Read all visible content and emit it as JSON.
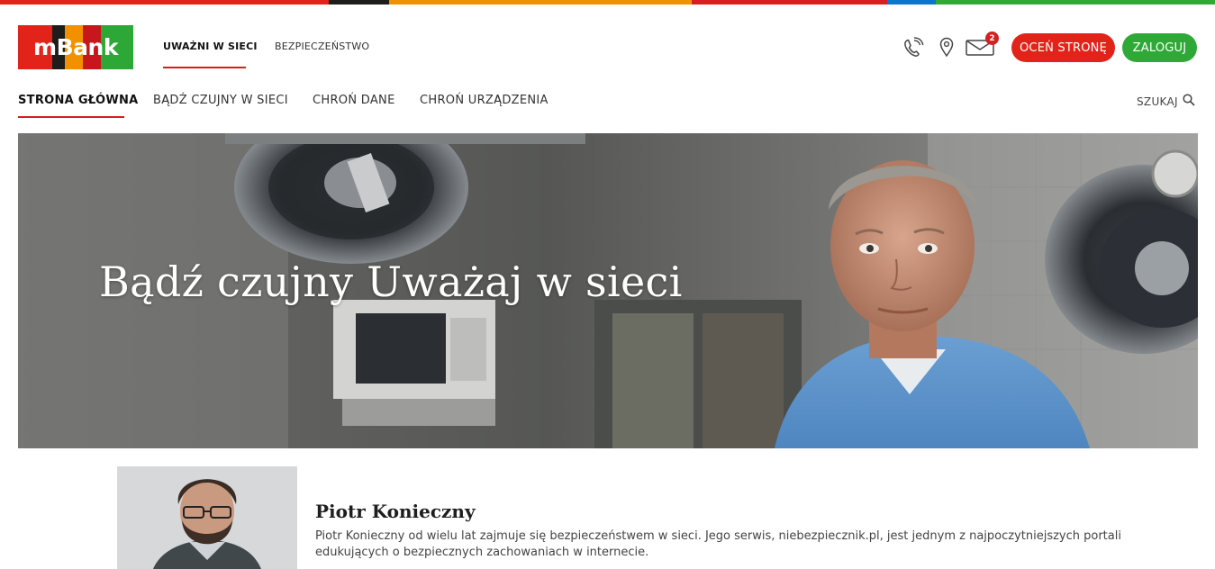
{
  "brand": {
    "name": "mBank",
    "stripe_colors": [
      "#e2231a",
      "#1d1d1b",
      "#f29100",
      "#d81e1e",
      "#0a78c8",
      "#34a836"
    ],
    "logo_colors": [
      "#e2231a",
      "#1d1d1b",
      "#f29100",
      "#c7161d",
      "#2da836"
    ]
  },
  "top_nav": {
    "tabs": [
      {
        "label": "UWAŻNI W SIECI",
        "active": true
      },
      {
        "label": "BEZPIECZEŃSTWO",
        "active": false
      }
    ]
  },
  "utility": {
    "icons": [
      "phone-icon",
      "location-pin-icon",
      "mail-icon"
    ],
    "mail_badge": "2",
    "rate_button": "OCEŃ STRONĘ",
    "login_button": "ZALOGUJ",
    "rate_color": "#e2231a",
    "login_color": "#2ea836"
  },
  "sub_nav": {
    "items": [
      {
        "label": "STRONA GŁÓWNA",
        "active": true
      },
      {
        "label": "BĄDŹ CZUJNY W SIECI",
        "active": false
      },
      {
        "label": "CHROŃ DANE",
        "active": false
      },
      {
        "label": "CHROŃ URZĄDZENIA",
        "active": false
      }
    ],
    "search_label": "SZUKAJ"
  },
  "hero": {
    "title": "Bądź czujny Uważaj w sieci"
  },
  "profile": {
    "name": "Piotr Konieczny",
    "bio": "Piotr Konieczny od wielu lat zajmuje się bezpieczeństwem w sieci. Jego serwis, niebezpiecznik.pl, jest jednym z najpoczytniejszych portali edukujących o bezpiecznych zachowaniach w internecie."
  }
}
